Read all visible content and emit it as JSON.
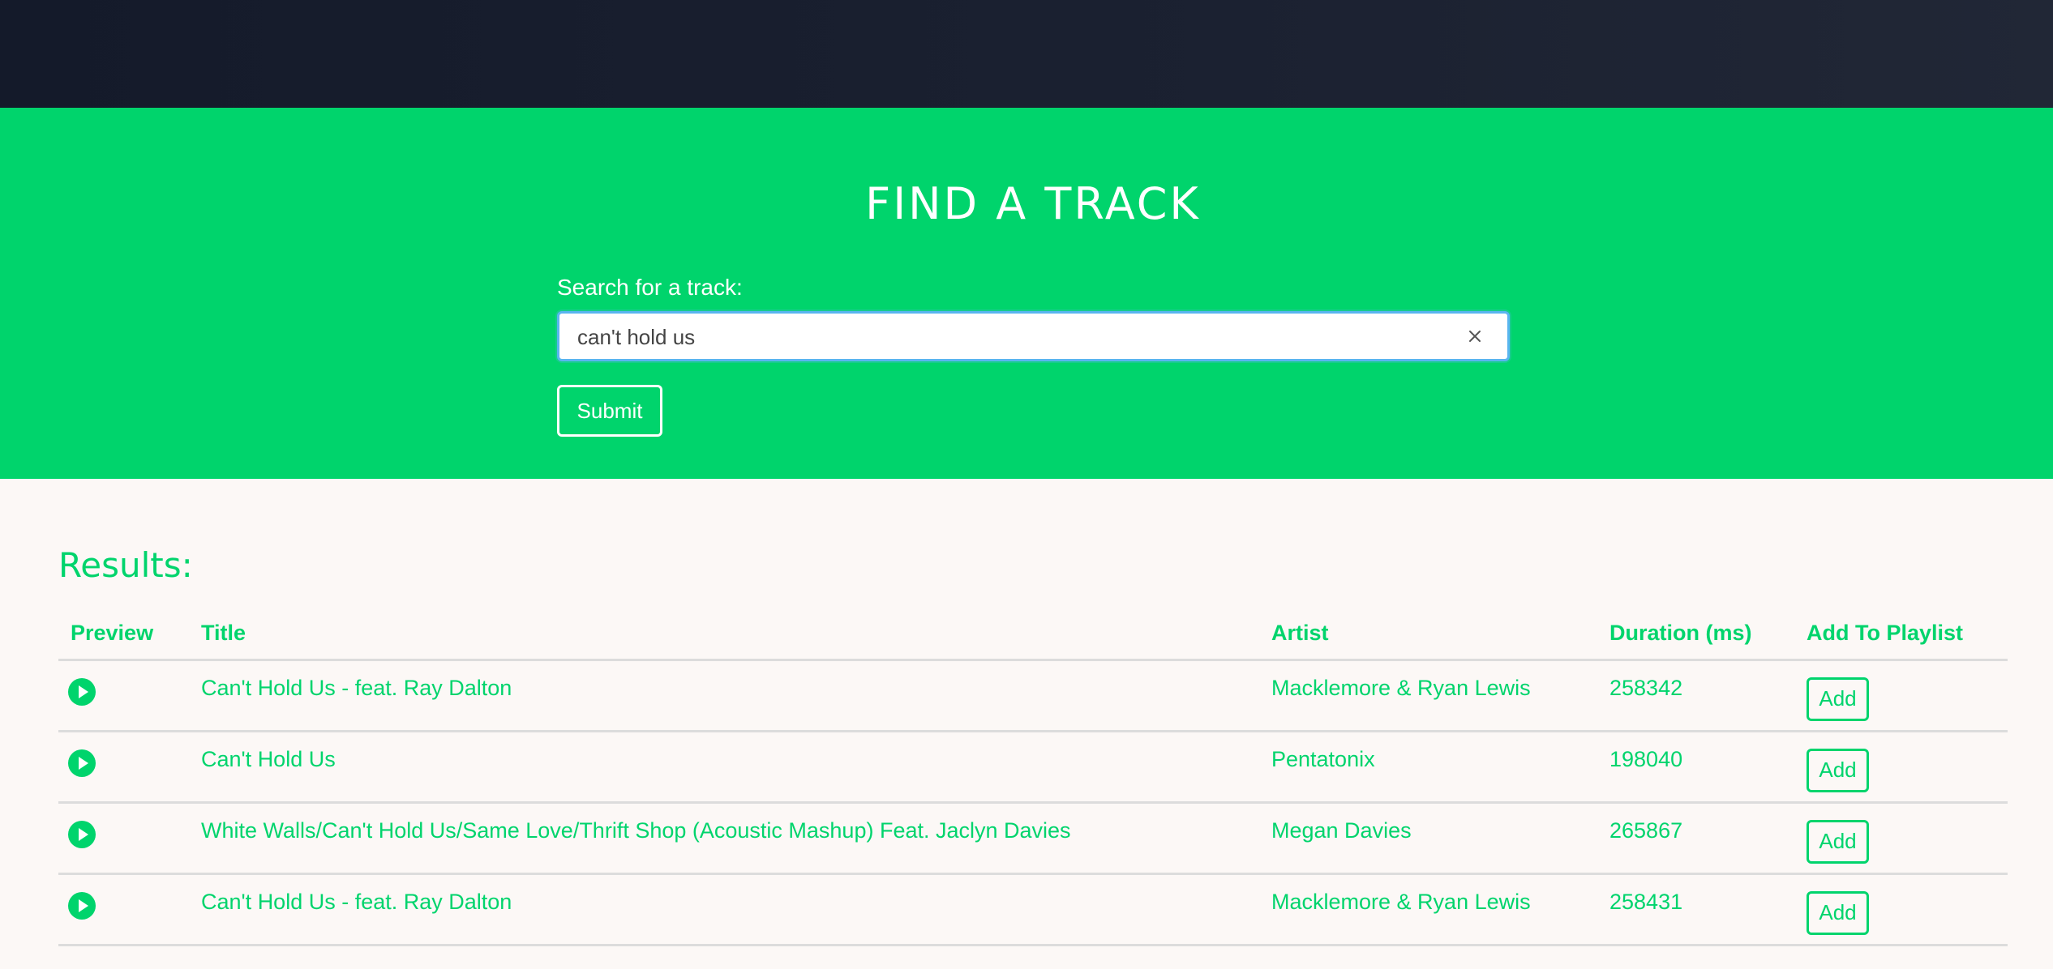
{
  "hero": {
    "title": "FIND A TRACK",
    "search_label": "Search for a track:",
    "search_value": "can't hold us",
    "submit_label": "Submit"
  },
  "results": {
    "heading": "Results:",
    "columns": [
      "Preview",
      "Title",
      "Artist",
      "Duration (ms)",
      "Add To Playlist"
    ],
    "add_label": "Add",
    "rows": [
      {
        "title": "Can't Hold Us - feat. Ray Dalton",
        "artist": "Macklemore & Ryan Lewis",
        "duration": "258342"
      },
      {
        "title": "Can't Hold Us",
        "artist": "Pentatonix",
        "duration": "198040"
      },
      {
        "title": "White Walls/Can't Hold Us/Same Love/Thrift Shop (Acoustic Mashup) Feat. Jaclyn Davies",
        "artist": "Megan Davies",
        "duration": "265867"
      },
      {
        "title": "Can't Hold Us - feat. Ray Dalton",
        "artist": "Macklemore & Ryan Lewis",
        "duration": "258431"
      }
    ]
  },
  "icons": {
    "play": "play-circle-icon",
    "clear": "close-icon"
  },
  "colors": {
    "accent": "#00d46c",
    "header_bg": "#1b2131",
    "page_bg": "#fcf8f6",
    "input_focus": "#5ab5f0"
  }
}
